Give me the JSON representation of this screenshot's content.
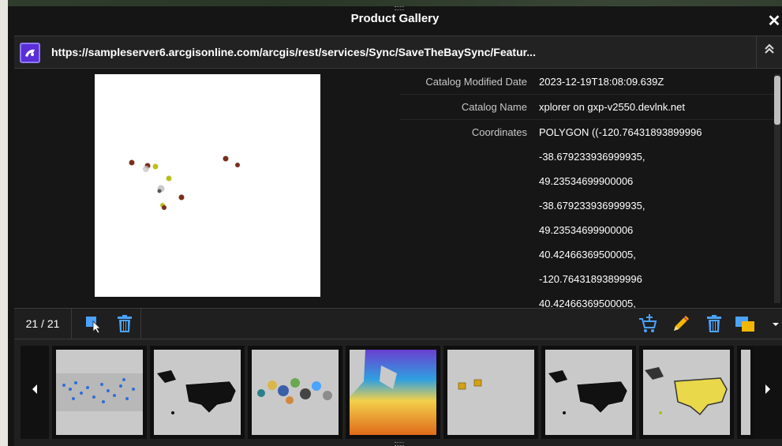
{
  "dialog": {
    "title": "Product Gallery",
    "close_symbol": "✕"
  },
  "urlbar": {
    "url": "https://sampleserver6.arcgisonline.com/arcgis/rest/services/Sync/SaveTheBaySync/Featur...",
    "icon": "gallery-app-icon",
    "collapse_symbol": "⌃"
  },
  "metadata": [
    {
      "label": "Catalog Modified Date",
      "value": "2023-12-19T18:08:09.639Z"
    },
    {
      "label": "Catalog Name",
      "value": "xplorer on gxp-v2550.devlnk.net"
    },
    {
      "label": "Coordinates",
      "value": "POLYGON ((-120.76431893899996"
    },
    {
      "label": "",
      "value": "-38.679233936999935,"
    },
    {
      "label": "",
      "value": "49.23534699900006"
    },
    {
      "label": "",
      "value": "-38.679233936999935,"
    },
    {
      "label": "",
      "value": "49.23534699900006"
    },
    {
      "label": "",
      "value": "40.42466369500005,"
    },
    {
      "label": "",
      "value": "-120.76431893899996"
    },
    {
      "label": "",
      "value": "40.42466369500005,"
    }
  ],
  "toolbar": {
    "count": "21 / 21",
    "left_icons": [
      "select-cursor-icon",
      "delete-all-icon"
    ],
    "right_icons": [
      "cart-add-icon",
      "edit-pencil-icon",
      "trash-icon",
      "overlay-icon",
      "dropdown-caret-icon"
    ]
  },
  "thumbnails": [
    {
      "name": "thumb-world-points"
    },
    {
      "name": "thumb-us-black-map"
    },
    {
      "name": "thumb-pie-symbols"
    },
    {
      "name": "thumb-color-raster"
    },
    {
      "name": "thumb-two-polygons"
    },
    {
      "name": "thumb-us-black-map-2"
    },
    {
      "name": "thumb-us-yellow-points"
    },
    {
      "name": "thumb-partial"
    }
  ],
  "colors": {
    "dialog_bg": "#151515",
    "accent_icon": "#5a2fd6",
    "toolbar_blue": "#4aa3ff",
    "overlay_yellow": "#f2b705"
  }
}
